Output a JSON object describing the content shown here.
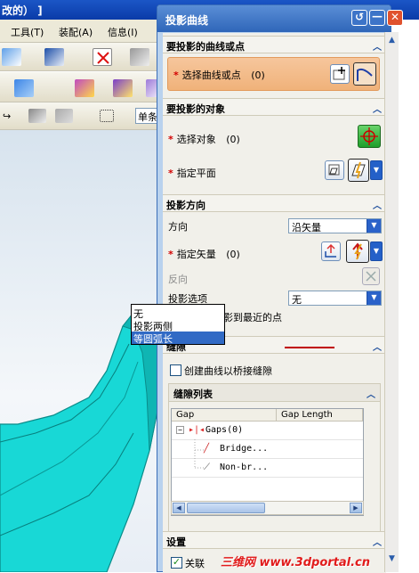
{
  "app": {
    "title_fragment": "改的） ]",
    "menu": [
      {
        "label": "工具(T)"
      },
      {
        "label": "装配(A)"
      },
      {
        "label": "信息(I)"
      }
    ],
    "toolbar_field": "单条"
  },
  "dialog": {
    "title": "投影曲线",
    "sections": {
      "curves": {
        "header": "要投影的曲线或点",
        "select_label": "选择曲线或点",
        "select_count": "(0)"
      },
      "objects": {
        "header": "要投影的对象",
        "select_label": "选择对象",
        "select_count": "(0)",
        "plane_label": "指定平面"
      },
      "direction": {
        "header": "投影方向",
        "direction_label": "方向",
        "direction_value": "沿矢量",
        "vector_label": "指定矢量",
        "vector_count": "(0)",
        "reverse_label": "反向",
        "options_label": "投影选项",
        "options_value": "无",
        "options_list": [
          "无",
          "投影两侧",
          "等圆弧长"
        ],
        "checkbox_label": "沿矢量投影到最近的点"
      },
      "gap": {
        "header": "缝隙",
        "bridge_checkbox": "创建曲线以桥接缝隙",
        "list_header": "缝隙列表",
        "columns": [
          "Gap",
          "Gap Length"
        ],
        "rows": [
          {
            "label": "Gaps(0)"
          },
          {
            "label": "Bridge..."
          },
          {
            "label": "Non-br..."
          }
        ]
      },
      "settings": {
        "header": "设置",
        "associative_label": "关联"
      }
    }
  },
  "watermark": "三维网 www.3dportal.cn",
  "colors": {
    "title_blue": "#2f66b9",
    "accent_orange": "#f0b27a",
    "required_star": "#d30000",
    "annotation_red": "#c00000",
    "highlight": "#316ac5",
    "part_cyan": "#1fe0de"
  }
}
